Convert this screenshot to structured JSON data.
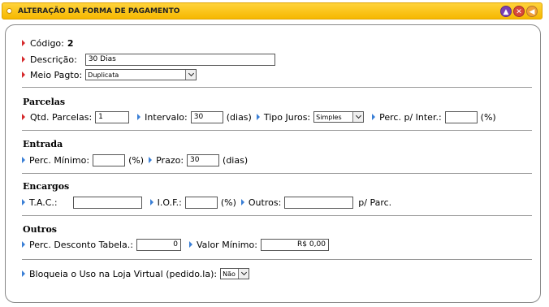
{
  "window": {
    "title": "ALTERAÇÃO DA FORMA DE PAGAMENTO",
    "buttons": [
      "▲",
      "✕",
      "◀"
    ]
  },
  "codigo": {
    "label": "Código:",
    "value": "2"
  },
  "descricao": {
    "label": "Descrição:",
    "value": "30 Dias"
  },
  "meio_pagto": {
    "label": "Meio Pagto:",
    "selected": "Duplicata"
  },
  "parcelas": {
    "title": "Parcelas",
    "qtd_label": "Qtd. Parcelas:",
    "qtd_value": "1",
    "intervalo_label": "Intervalo:",
    "intervalo_value": "30",
    "intervalo_unit": "(dias)",
    "tipo_juros_label": "Tipo Juros:",
    "tipo_juros_selected": "Simples",
    "perc_label": "Perc. p/ Inter.:",
    "perc_value": "",
    "perc_unit": "(%)"
  },
  "entrada": {
    "title": "Entrada",
    "perc_min_label": "Perc. Mínimo:",
    "perc_min_value": "",
    "perc_min_unit": "(%)",
    "prazo_label": "Prazo:",
    "prazo_value": "30",
    "prazo_unit": "(dias)"
  },
  "encargos": {
    "title": "Encargos",
    "tac_label": "T.A.C.:",
    "tac_value": "",
    "iof_label": "I.O.F.:",
    "iof_value": "",
    "iof_unit": "(%)",
    "outros_label": "Outros:",
    "outros_value": "",
    "outros_unit": "p/ Parc."
  },
  "outros": {
    "title": "Outros",
    "desconto_label": "Perc. Desconto Tabela.:",
    "desconto_value": "0",
    "valor_min_label": "Valor Mínimo:",
    "valor_min_value": "R$ 0,00"
  },
  "bloqueia": {
    "label": "Bloqueia o Uso na Loja Virtual (pedido.la):",
    "selected": "Não"
  }
}
